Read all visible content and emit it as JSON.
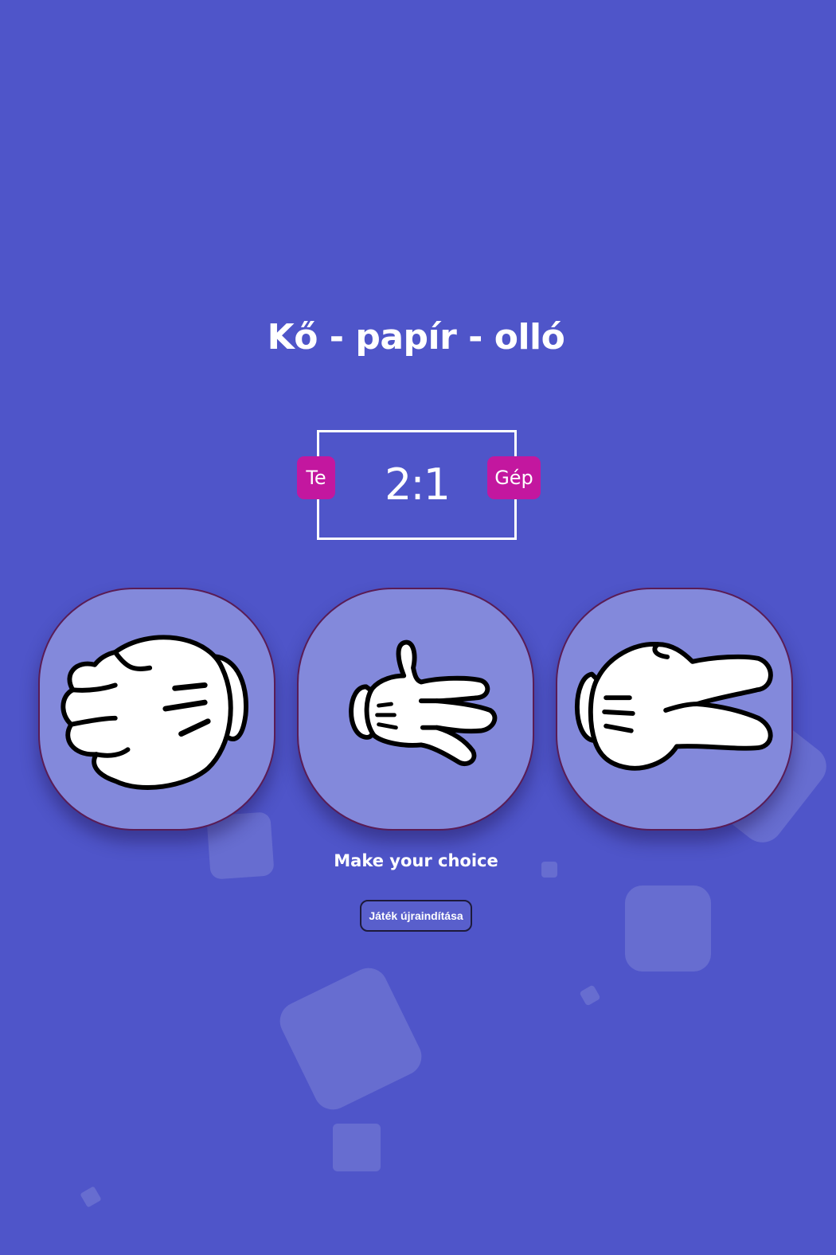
{
  "title": "Kő - papír - olló",
  "scoreboard": {
    "score": "2:1",
    "user_label": "Te",
    "computer_label": "Gép"
  },
  "choices": [
    {
      "icon": "rock-fist-icon"
    },
    {
      "icon": "paper-hand-icon"
    },
    {
      "icon": "scissors-hand-icon"
    }
  ],
  "prompt": "Make your choice",
  "reset_label": "Játék újraindítása",
  "colors": {
    "background": "#4f55c9",
    "badge": "#c3179f",
    "choice_bg": "#8389db",
    "choice_border": "#5a1c55"
  }
}
